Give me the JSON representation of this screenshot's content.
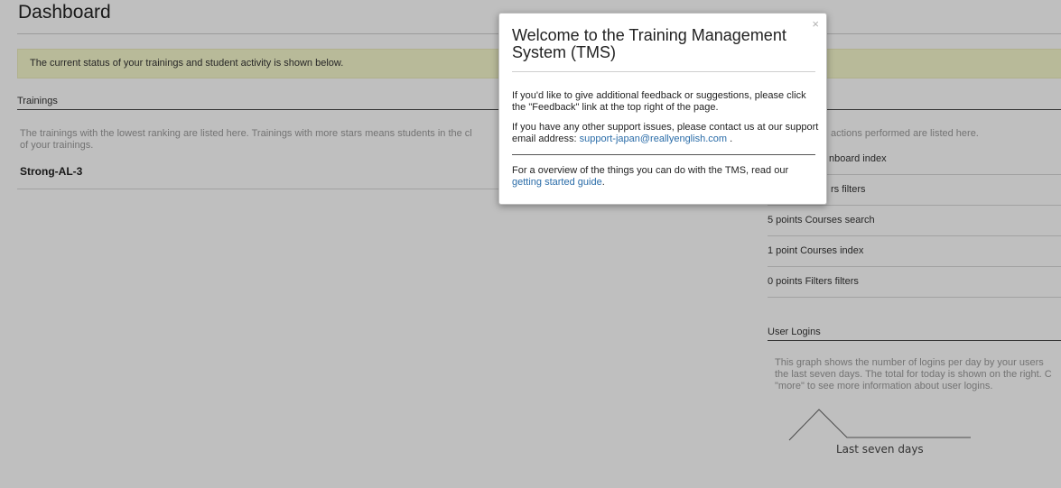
{
  "dashboard": {
    "title": "Dashboard",
    "status_message": "The current status of your trainings and student activity is shown below."
  },
  "trainings": {
    "heading": "Trainings",
    "description_line1": "The trainings with the lowest ranking are listed here. Trainings with more stars means students in the cl",
    "description_line2": "of your trainings.",
    "items": [
      {
        "name": "Strong-AL-3"
      }
    ]
  },
  "activity": {
    "description": "actions performed are listed here.",
    "items": [
      {
        "label": "nboard index"
      },
      {
        "label": "rs filters"
      },
      {
        "label": "5 points Courses search"
      },
      {
        "label": "1 point Courses index"
      },
      {
        "label": "0 points Filters filters"
      }
    ]
  },
  "user_logins": {
    "heading": "User Logins",
    "description_line1": "This graph shows the number of logins per day by your users",
    "description_line2": "the last seven days. The total for today is shown on the right. C",
    "description_line3": "\"more\" to see more information about user logins.",
    "chart_label": "Last seven days"
  },
  "modal": {
    "close_glyph": "×",
    "title": "Welcome to the Training Management System (TMS)",
    "feedback_text": "If you'd like to give additional feedback or suggestions, please click the \"Feedback\" link at the top right of the page.",
    "support_text": "If you have any other support issues, please contact us at our support email address:",
    "support_email": "support-japan@reallyenglish.com",
    "support_suffix": " .",
    "guide_text": "For a overview of the things you can do with the TMS, read our",
    "guide_link": "getting started guide",
    "guide_suffix": "."
  },
  "colors": {
    "status_bg": "#f6f8cc",
    "link": "#2a6ca8",
    "overlay": "rgba(0,0,0,0.25)"
  }
}
